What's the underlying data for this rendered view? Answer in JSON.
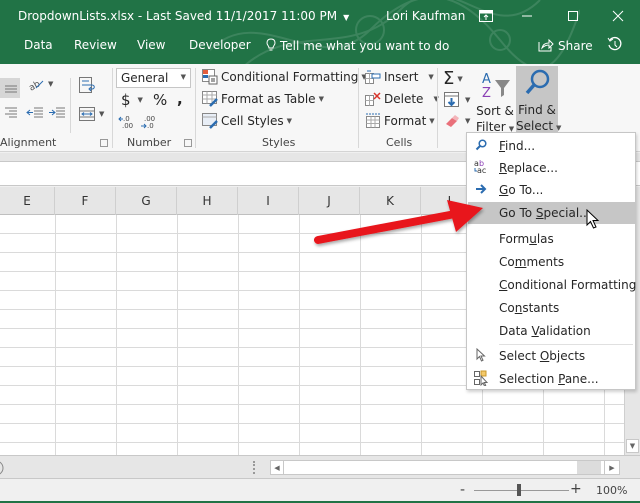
{
  "window": {
    "title": "DropdownLists.xlsx  -  Last Saved 11/1/2017 11:00 PM",
    "user": "Lori Kaufman",
    "controls": [
      "ribbon-display-options",
      "minimize",
      "maximize",
      "close"
    ]
  },
  "tabs": [
    {
      "label": "Data"
    },
    {
      "label": "Review"
    },
    {
      "label": "View"
    },
    {
      "label": "Developer"
    }
  ],
  "tell_me": "Tell me what you want to do",
  "share_label": "Share",
  "ribbon": {
    "alignment": {
      "label": "Alignment"
    },
    "number": {
      "label": "Number",
      "format_value": "General",
      "symbols": [
        "$",
        "%",
        ","
      ],
      "decimals": [
        ".0→.00",
        ".00→.0"
      ]
    },
    "styles": {
      "label": "Styles",
      "buttons": [
        "Conditional Formatting",
        "Format as Table",
        "Cell Styles"
      ]
    },
    "cells": {
      "label": "Cells",
      "buttons": [
        "Insert",
        "Delete",
        "Format"
      ]
    },
    "editing": {
      "sort_filter": [
        "Sort &",
        "Filter"
      ],
      "find_select": [
        "Find &",
        "Select"
      ]
    }
  },
  "columns": [
    "E",
    "F",
    "G",
    "H",
    "I",
    "J",
    "K",
    "L"
  ],
  "menu": {
    "items": [
      {
        "label": "Find...",
        "accel": "F",
        "icon": "search-icon"
      },
      {
        "label": "Replace...",
        "accel": "R",
        "icon": "replace-icon"
      },
      {
        "label": "Go To...",
        "accel": "G",
        "icon": "arrow-right-icon"
      },
      {
        "label": "Go To Special...",
        "accel": "S",
        "icon": "",
        "highlighted": true
      },
      {
        "label": "Formulas",
        "accel": "u",
        "icon": ""
      },
      {
        "label": "Comments",
        "accel": "m",
        "icon": ""
      },
      {
        "label": "Conditional Formatting",
        "accel": "C",
        "icon": ""
      },
      {
        "label": "Constants",
        "accel": "n",
        "icon": ""
      },
      {
        "label": "Data Validation",
        "accel": "V",
        "icon": ""
      },
      {
        "label": "Select Objects",
        "accel": "O",
        "icon": "pointer-icon"
      },
      {
        "label": "Selection Pane...",
        "accel": "P",
        "icon": "selection-pane-icon"
      }
    ]
  },
  "status": {
    "zoom": "100%",
    "zoom_minus": "-",
    "zoom_plus": "+"
  },
  "annotation": {
    "arrow_color": "#e8141b"
  },
  "colors": {
    "accent": "#217346",
    "menu_highlight": "#c6c6c6"
  }
}
